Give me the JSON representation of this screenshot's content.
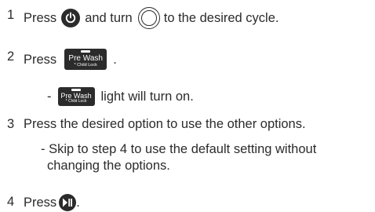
{
  "steps": [
    {
      "number": "1",
      "text_a": "Press",
      "text_b": "and turn",
      "text_c": "to the desired cycle."
    },
    {
      "number": "2",
      "text_a": "Press",
      "text_b": "."
    },
    {
      "number": "3",
      "text_a": "Press the desired option to use the other options."
    },
    {
      "number": "4",
      "text_a": "Press",
      "text_b": "."
    }
  ],
  "step2_note": {
    "dash": "-",
    "text": "light will turn on."
  },
  "step3_note": {
    "line1": "- Skip to step 4 to use the default setting without",
    "line2": "changing the options."
  },
  "prewash_button": {
    "label": "Pre Wash",
    "sublabel": "* Child Lock"
  },
  "icons": {
    "power": "power-icon",
    "dial": "cycle-dial-icon",
    "prewash": "prewash-button-icon",
    "start": "play-pause-icon"
  },
  "colors": {
    "text": "#2b2b2b",
    "icon_fill": "#2b2b2b"
  }
}
